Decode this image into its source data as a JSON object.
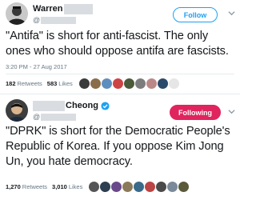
{
  "tweets": [
    {
      "display_name": "Warren",
      "handle_prefix": "@",
      "follow_label": "Follow",
      "text": "\"Antifa\" is short for anti-fascist. The only ones who should oppose antifa are fascists.",
      "timestamp": "3:20 PM - 27 Aug 2017",
      "retweets_count": "182",
      "retweets_label": "Retweets",
      "likes_count": "583",
      "likes_label": "Likes",
      "faces": [
        "#3b3b3b",
        "#8a6d4a",
        "#5c8fbf",
        "#c44",
        "#4a5a3a",
        "#7d7d7d",
        "#b88",
        "#2a4a6a",
        "#e6e6e6"
      ]
    },
    {
      "display_name": "Cheong",
      "handle_prefix": "@",
      "verified": true,
      "follow_label": "Following",
      "text": "\"DPRK\" is short for the Democratic People's Republic of Korea. If you oppose Kim Jong Un, you hate democracy.",
      "retweets_count": "1,270",
      "retweets_label": "Retweets",
      "likes_count": "3,010",
      "likes_label": "Likes",
      "faces": [
        "#555",
        "#2c3e50",
        "#6a4a8a",
        "#8a7a5a",
        "#3a6a8a",
        "#b44",
        "#4a4a4a",
        "#7a8a9a",
        "#5a5a3a"
      ]
    }
  ],
  "colors": {
    "accent": "#1da1f2",
    "following": "#e0245e",
    "muted": "#657786",
    "redaction": "#d9dde1"
  }
}
